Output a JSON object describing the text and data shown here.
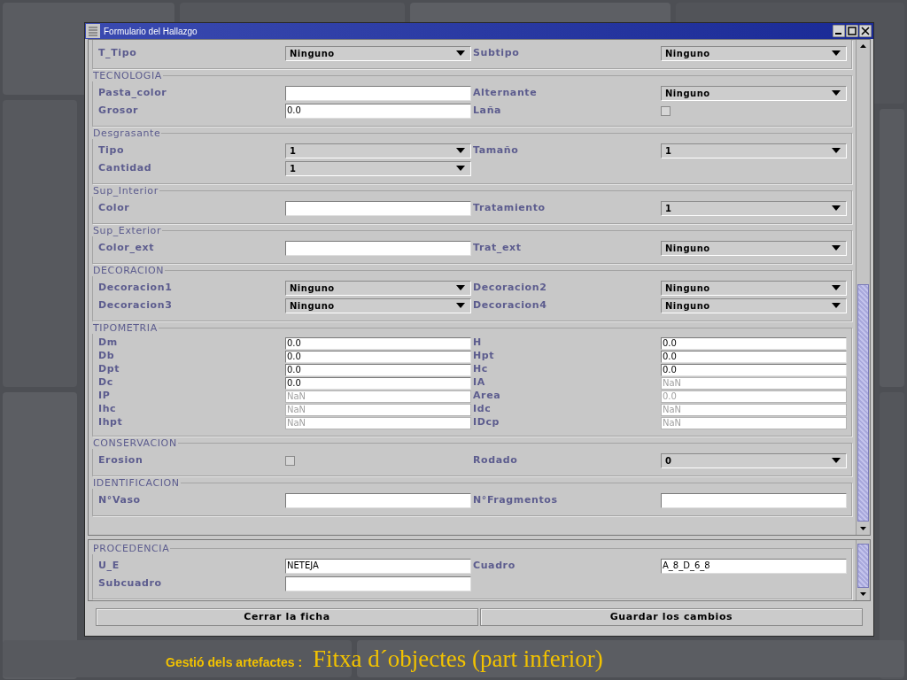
{
  "window": {
    "title": "Formulario del Hallazgo"
  },
  "upper_sections": [
    {
      "rows": [
        [
          {
            "label": "T_Tipo",
            "kind": "select",
            "value": "Ninguno"
          },
          {
            "label": "Subtipo",
            "kind": "select",
            "value": "Ninguno"
          }
        ]
      ]
    },
    {
      "title": "TECNOLOGIA",
      "rows": [
        [
          {
            "label": "Pasta_color",
            "kind": "text"
          },
          {
            "label": "Alternante",
            "kind": "select",
            "value": "Ninguno"
          }
        ],
        [
          {
            "label": "Grosor",
            "kind": "text",
            "value": "0.0",
            "disabled": false
          },
          {
            "label": "Laña",
            "kind": "checkbox",
            "checked": false
          }
        ]
      ]
    },
    {
      "title": "Desgrasante",
      "rows": [
        [
          {
            "label": "Tipo",
            "kind": "select",
            "value": "1"
          },
          {
            "label": "Tamaño",
            "kind": "select",
            "value": "1"
          }
        ],
        [
          {
            "label": "Cantidad",
            "kind": "select",
            "value": "1"
          }
        ]
      ]
    },
    {
      "title": "Sup_Interior",
      "rows": [
        [
          {
            "label": "Color",
            "kind": "text"
          },
          {
            "label": "Tratamiento",
            "kind": "select",
            "value": "1"
          }
        ]
      ]
    },
    {
      "title": "Sup_Exterior",
      "rows": [
        [
          {
            "label": "Color_ext",
            "kind": "text"
          },
          {
            "label": "Trat_ext",
            "kind": "select",
            "value": "Ninguno"
          }
        ]
      ]
    },
    {
      "title": "DECORACION",
      "rows": [
        [
          {
            "label": "Decoracion1",
            "kind": "select",
            "value": "Ninguno"
          },
          {
            "label": "Decoracion2",
            "kind": "select",
            "value": "Ninguno"
          }
        ],
        [
          {
            "label": "Decoracion3",
            "kind": "select",
            "value": "Ninguno"
          },
          {
            "label": "Decoracion4",
            "kind": "select",
            "value": "Ninguno"
          }
        ]
      ]
    },
    {
      "title": "TIPOMETRIA",
      "rows": [
        [
          {
            "label": "Dm",
            "kind": "text",
            "value": "0.0",
            "disabled": false
          },
          {
            "label": "H",
            "kind": "text",
            "value": "0.0",
            "disabled": false
          }
        ],
        [
          {
            "label": "Db",
            "kind": "text",
            "value": "0.0",
            "disabled": false
          },
          {
            "label": "Hpt",
            "kind": "text",
            "value": "0.0",
            "disabled": false
          }
        ],
        [
          {
            "label": "Dpt",
            "kind": "text",
            "value": "0.0",
            "disabled": false
          },
          {
            "label": "Hc",
            "kind": "text",
            "value": "0.0",
            "disabled": false
          }
        ],
        [
          {
            "label": "Dc",
            "kind": "text",
            "value": "0.0",
            "disabled": false
          },
          {
            "label": "IA",
            "kind": "text",
            "value": "NaN",
            "disabled": true
          }
        ],
        [
          {
            "label": "IP",
            "kind": "text",
            "value": "NaN",
            "disabled": true
          },
          {
            "label": "Area",
            "kind": "text",
            "value": "0.0",
            "disabled": true
          }
        ],
        [
          {
            "label": "Ihc",
            "kind": "text",
            "value": "NaN",
            "disabled": true
          },
          {
            "label": "Idc",
            "kind": "text",
            "value": "NaN",
            "disabled": true
          }
        ],
        [
          {
            "label": "Ihpt",
            "kind": "text",
            "value": "NaN",
            "disabled": true
          },
          {
            "label": "IDcp",
            "kind": "text",
            "value": "NaN",
            "disabled": true
          }
        ]
      ]
    },
    {
      "title": "CONSERVACION",
      "rows": [
        [
          {
            "label": "Erosion",
            "kind": "checkbox",
            "checked": false
          },
          {
            "label": "Rodado",
            "kind": "select",
            "value": "0"
          }
        ]
      ]
    },
    {
      "title": "IDENTIFICACION",
      "rows": [
        [
          {
            "label": "N°Vaso",
            "kind": "text"
          },
          {
            "label": "N°Fragmentos",
            "kind": "text"
          }
        ]
      ]
    }
  ],
  "lower_sections": [
    {
      "title": "PROCEDENCIA",
      "rows": [
        [
          {
            "label": "U_E",
            "kind": "text",
            "value": "NETEJA",
            "disabled": false
          },
          {
            "label": "Cuadro",
            "kind": "text",
            "value": "A_8_D_6_8",
            "disabled": false
          }
        ],
        [
          {
            "label": "Subcuadro",
            "kind": "text"
          }
        ]
      ]
    }
  ],
  "buttons": [
    "Cerrar la ficha",
    "Guardar los cambios"
  ],
  "caption": {
    "lead": "Gestió dels artefactes :",
    "title": "Fitxa d´objectes (part inferior)"
  }
}
